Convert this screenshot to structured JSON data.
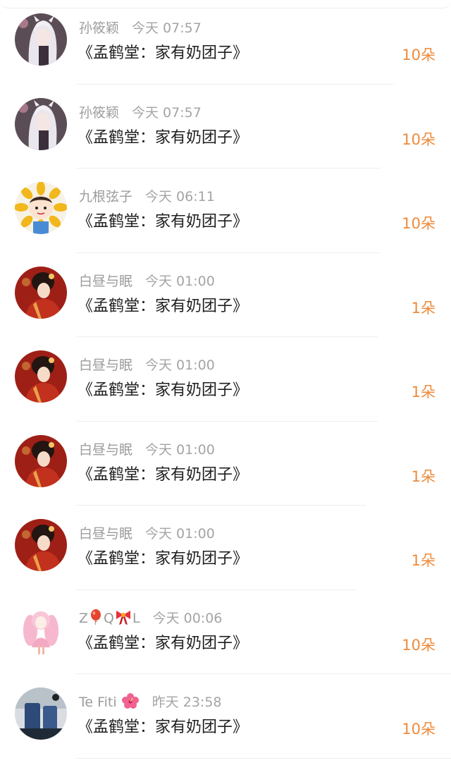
{
  "gifts": [
    {
      "user": "孙筱颖",
      "time": "今天 07:57",
      "message": "《孟鹤堂：家有奶团子》",
      "amount": "10朵",
      "avatar": "anime-girl-white-hair"
    },
    {
      "user": "孙筱颖",
      "time": "今天 07:57",
      "message": "《孟鹤堂：家有奶团子》",
      "amount": "10朵",
      "avatar": "anime-girl-white-hair"
    },
    {
      "user": "九根弦子",
      "time": "今天 06:11",
      "message": "《孟鹤堂：家有奶团子》",
      "amount": "10朵",
      "avatar": "sunflower-boy"
    },
    {
      "user": "白昼与眠",
      "time": "今天 01:00",
      "message": "《孟鹤堂：家有奶团子》",
      "amount": "1朵",
      "avatar": "red-dress-lady"
    },
    {
      "user": "白昼与眠",
      "time": "今天 01:00",
      "message": "《孟鹤堂：家有奶团子》",
      "amount": "1朵",
      "avatar": "red-dress-lady"
    },
    {
      "user": "白昼与眠",
      "time": "今天 01:00",
      "message": "《孟鹤堂：家有奶团子》",
      "amount": "1朵",
      "avatar": "red-dress-lady"
    },
    {
      "user": "白昼与眠",
      "time": "今天 01:00",
      "message": "《孟鹤堂：家有奶团子》",
      "amount": "1朵",
      "avatar": "red-dress-lady"
    },
    {
      "user": "ZQL",
      "user_parts": [
        "Z",
        "Q",
        "L"
      ],
      "user_emojis": [
        "balloon-emoji",
        "ribbon-emoji"
      ],
      "time": "今天 00:06",
      "message": "《孟鹤堂：家有奶团子》",
      "amount": "10朵",
      "avatar": "pink-hair-girl"
    },
    {
      "user": "Te Fiti",
      "user_emoji": "hibiscus-emoji",
      "time": "昨天 23:58",
      "message": "《孟鹤堂：家有奶团子》",
      "amount": "10朵",
      "avatar": "blue-chair-photo"
    }
  ],
  "colors": {
    "username": "#9c9c9c",
    "message": "#1f1f1f",
    "amount": "#ee8a3a",
    "divider": "#efefef",
    "background": "#ffffff"
  }
}
